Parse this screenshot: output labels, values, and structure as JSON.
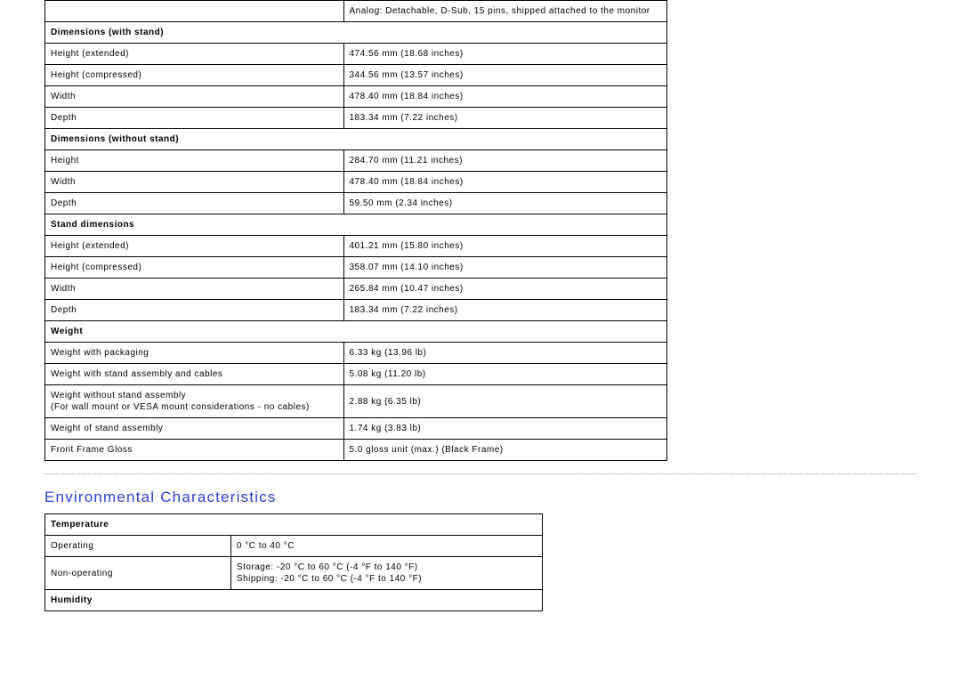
{
  "spec_table": {
    "analog_row": {
      "value": "Analog: Detachable, D-Sub, 15 pins, shipped attached to the monitor"
    },
    "sections": [
      {
        "header": "Dimensions (with stand)",
        "rows": [
          {
            "label": "Height (extended)",
            "value": "474.56 mm (18.68 inches)"
          },
          {
            "label": "Height (compressed)",
            "value": "344.56 mm (13.57 inches)"
          },
          {
            "label": "Width",
            "value": "478.40 mm (18.84 inches)"
          },
          {
            "label": "Depth",
            "value": "183.34 mm (7.22 inches)"
          }
        ]
      },
      {
        "header": "Dimensions (without stand)",
        "rows": [
          {
            "label": "Height",
            "value": "284.70 mm (11.21 inches)"
          },
          {
            "label": "Width",
            "value": "478.40 mm (18.84 inches)"
          },
          {
            "label": "Depth",
            "value": "59.50 mm (2.34 inches)"
          }
        ]
      },
      {
        "header": "Stand dimensions",
        "rows": [
          {
            "label": "Height (extended)",
            "value": "401.21 mm (15.80 inches)"
          },
          {
            "label": "Height (compressed)",
            "value": "358.07 mm (14.10 inches)"
          },
          {
            "label": "Width",
            "value": "265.84 mm (10.47 inches)"
          },
          {
            "label": "Depth",
            "value": "183.34 mm (7.22 inches)"
          }
        ]
      },
      {
        "header": "Weight",
        "rows": [
          {
            "label": "Weight with packaging",
            "value": "6.33 kg (13.96 lb)"
          },
          {
            "label": "Weight with stand assembly and cables",
            "value": "5.08 kg (11.20 lb)"
          },
          {
            "label": "Weight without stand assembly\n(For wall mount or VESA mount considerations - no cables)",
            "value": "2.88 kg (6.35 lb)"
          },
          {
            "label": "Weight of stand assembly",
            "value": "1.74 kg (3.83 lb)"
          },
          {
            "label": "Front Frame Gloss",
            "value": "5.0 gloss unit (max.) (Black Frame)"
          }
        ]
      }
    ]
  },
  "env_section": {
    "title": "Environmental Characteristics",
    "sections": [
      {
        "header": "Temperature",
        "rows": [
          {
            "label": "Operating",
            "value": "0 °C to 40 °C"
          },
          {
            "label": "Non-operating",
            "value": "Storage: -20 °C to 60 °C (-4 °F to 140 °F)\nShipping: -20 °C to 60 °C (-4 °F to 140 °F)"
          }
        ]
      },
      {
        "header": "Humidity",
        "rows": []
      }
    ]
  }
}
